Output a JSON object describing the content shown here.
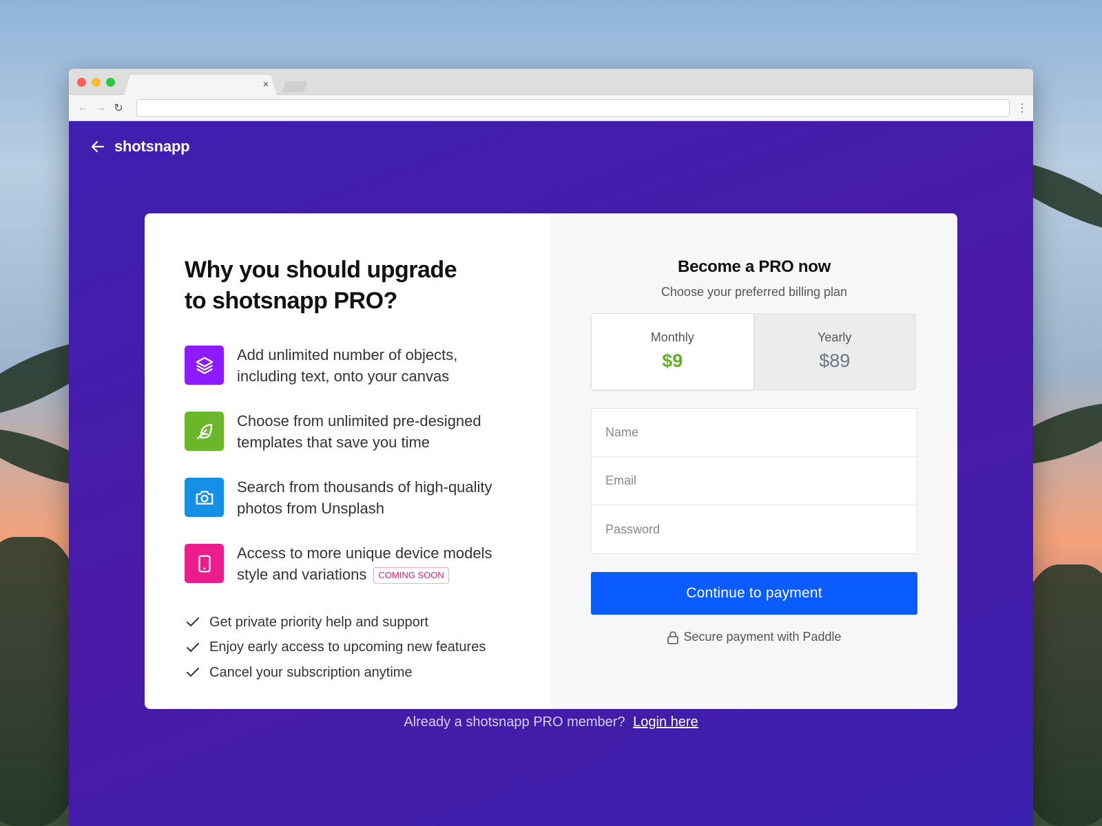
{
  "browser": {
    "tab_close": "×",
    "menu_dots": "⋮",
    "url_value": ""
  },
  "brand": {
    "name": "shotsnapp"
  },
  "left": {
    "headline_line1": "Why you should upgrade",
    "headline_line2": "to shotsnapp PRO?",
    "features": [
      {
        "icon": "layers-icon",
        "color": "#8e1bff",
        "line1": "Add unlimited number of objects,",
        "line2": "including text, onto your canvas"
      },
      {
        "icon": "feather-icon",
        "color": "#6ab72c",
        "line1": "Choose from unlimited pre-designed",
        "line2": "templates that save you time"
      },
      {
        "icon": "camera-icon",
        "color": "#1491e6",
        "line1": "Search from thousands of high-quality",
        "line2": "photos from Unsplash"
      },
      {
        "icon": "tablet-icon",
        "color": "#ec1c8d",
        "line1": "Access to more unique device models",
        "line2": "style and variations",
        "badge": "COMING SOON"
      }
    ],
    "checks": [
      "Get private priority help and support",
      "Enjoy early access to upcoming new features",
      "Cancel your subscription anytime"
    ]
  },
  "right": {
    "title": "Become a PRO now",
    "subtitle": "Choose your preferred billing plan",
    "plans": [
      {
        "label": "Monthly",
        "price": "$9",
        "selected": true
      },
      {
        "label": "Yearly",
        "price": "$89",
        "selected": false
      }
    ],
    "form": {
      "name_placeholder": "Name",
      "email_placeholder": "Email",
      "password_placeholder": "Password"
    },
    "cta_label": "Continue to payment",
    "secure_note": "Secure payment with Paddle"
  },
  "footer": {
    "prompt": "Already a shotsnapp PRO member?",
    "link": "Login here"
  },
  "colors": {
    "accent": "#0b5cff",
    "background": "#4a1aa6",
    "price_active": "#5fb128"
  }
}
